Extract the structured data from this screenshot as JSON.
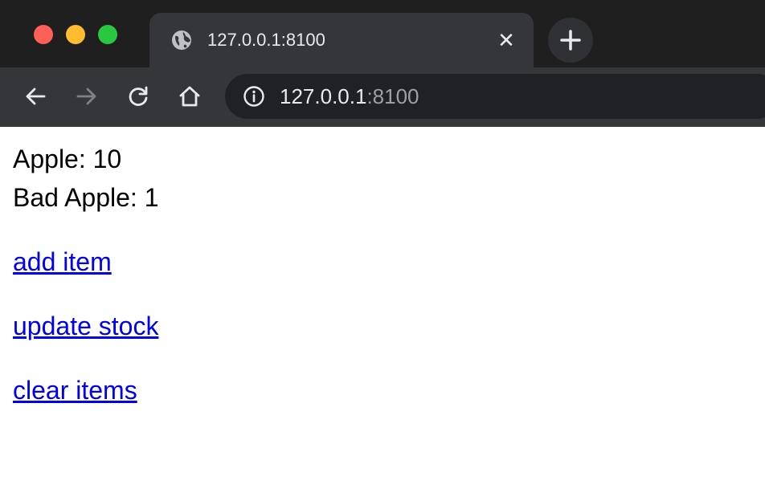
{
  "browser": {
    "tab": {
      "title": "127.0.0.1:8100",
      "icon": "globe-icon",
      "close_glyph": "✕"
    },
    "new_tab_icon": "plus-icon",
    "nav": {
      "back_icon": "arrow-left-icon",
      "forward_icon": "arrow-right-icon",
      "reload_icon": "reload-icon",
      "home_icon": "home-icon"
    },
    "address": {
      "host": "127.0.0.1",
      "port": ":8100",
      "info_icon": "info-icon"
    },
    "colors": {
      "close": "#fe5f57",
      "minimize": "#febc2e",
      "maximize": "#28c840",
      "link": "#0000ee"
    }
  },
  "page": {
    "stock": [
      {
        "name": "Apple",
        "count": "10",
        "text": "Apple: 10"
      },
      {
        "name": "Bad Apple",
        "count": "1",
        "text": "Bad Apple: 1"
      }
    ],
    "links": {
      "add_item": "add item",
      "update_stock": "update stock",
      "clear_items": "clear items"
    }
  }
}
